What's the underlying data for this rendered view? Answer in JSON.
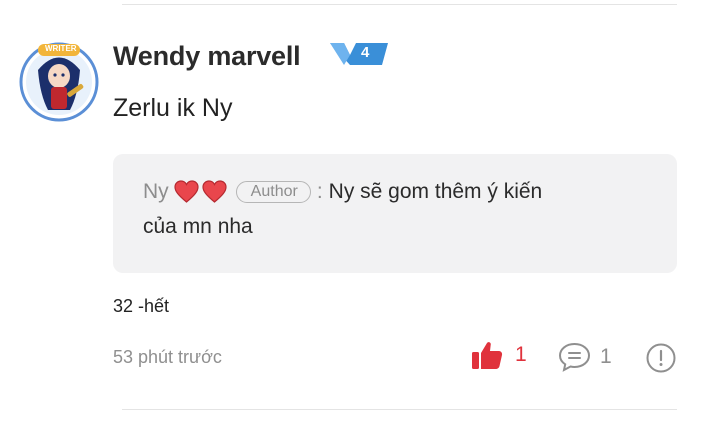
{
  "comment": {
    "avatar_badge_text": "WRITER",
    "author_name": "Wendy marvell",
    "level": "4",
    "text": "Zerlu ik Ny",
    "reply": {
      "author_name": "Ny",
      "author_tag": "Author",
      "colon": ":",
      "text_line1": "Ny sẽ gom thêm ý kiến",
      "text_line2": "của mn nha"
    },
    "footnote": "32 -hết",
    "timestamp": "53 phút trước",
    "like_count": "1",
    "reply_count": "1"
  },
  "colors": {
    "like_red": "#e0323c",
    "level_blue": "#3a8fd8",
    "reply_bg": "#f2f2f3"
  },
  "icons": [
    "avatar-image",
    "level-badge-icon",
    "heart-icon",
    "thumbs-up-icon",
    "comment-bubble-icon",
    "report-icon"
  ]
}
